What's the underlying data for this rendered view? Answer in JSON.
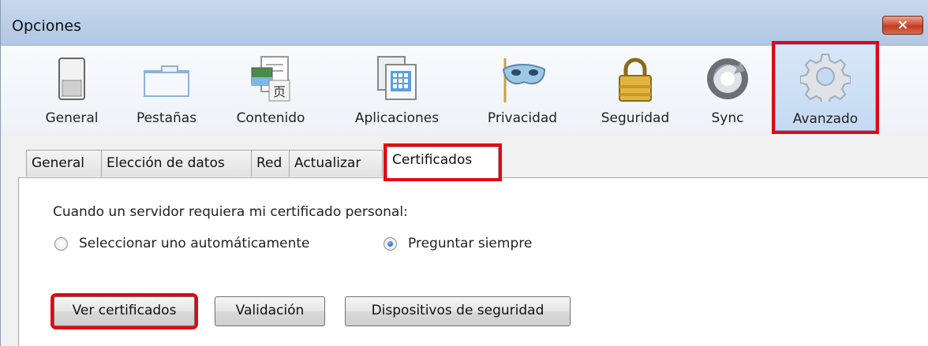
{
  "window": {
    "title": "Opciones",
    "close_label": "×"
  },
  "toolbar": {
    "items": [
      {
        "label": "General",
        "icon": "switch-icon",
        "selected": false
      },
      {
        "label": "Pestañas",
        "icon": "tabs-icon",
        "selected": false
      },
      {
        "label": "Contenido",
        "icon": "content-icon",
        "selected": false
      },
      {
        "label": "Aplicaciones",
        "icon": "applications-icon",
        "selected": false
      },
      {
        "label": "Privacidad",
        "icon": "mask-icon",
        "selected": false
      },
      {
        "label": "Seguridad",
        "icon": "padlock-icon",
        "selected": false
      },
      {
        "label": "Sync",
        "icon": "sync-icon",
        "selected": false
      },
      {
        "label": "Avanzado",
        "icon": "gear-icon",
        "selected": true
      }
    ]
  },
  "tabs": {
    "items": [
      {
        "label": "General",
        "active": false
      },
      {
        "label": "Elección de datos",
        "active": false
      },
      {
        "label": "Red",
        "active": false
      },
      {
        "label": "Actualizar",
        "active": false
      },
      {
        "label": "Certificados",
        "active": true
      }
    ]
  },
  "certificates": {
    "prompt": "Cuando un servidor requiera mi certificado personal:",
    "radio_auto": "Seleccionar uno automáticamente",
    "radio_ask": "Preguntar siempre",
    "selected_option": "Preguntar siempre"
  },
  "buttons": {
    "view_certs": "Ver certificados",
    "validation": "Validación",
    "security_devices": "Dispositivos de seguridad"
  },
  "colors": {
    "highlight_red": "#e30613",
    "selected_bg": "#c4daf3",
    "titlebar": "#b8cde7"
  }
}
